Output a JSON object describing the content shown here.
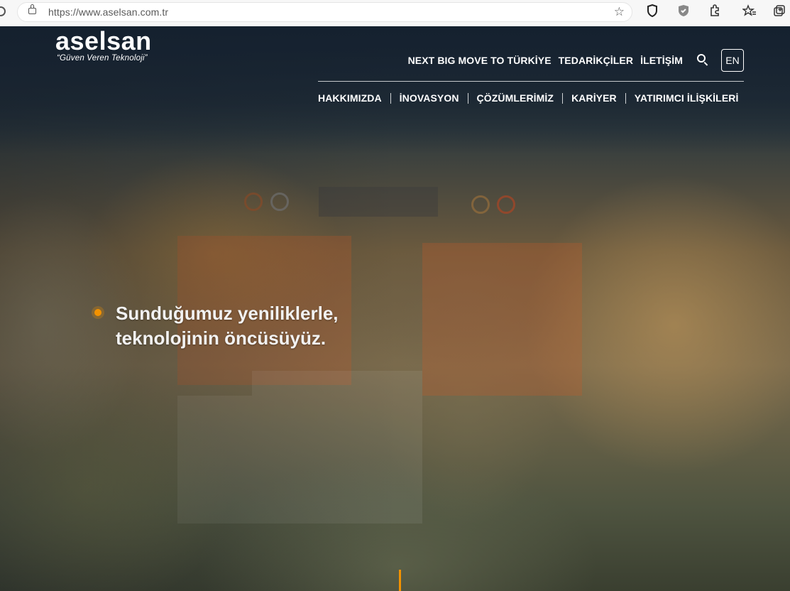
{
  "browser": {
    "url": "https://www.aselsan.com.tr",
    "icons": [
      "reload-icon",
      "lock-icon",
      "favorite-add-icon",
      "shield-icon",
      "tracking-icon",
      "extensions-icon",
      "favorites-icon",
      "collections-icon"
    ]
  },
  "site": {
    "logo_name": "aselsan",
    "logo_tagline": "“Güven Veren Teknoloji”"
  },
  "topnav": {
    "items": [
      "NEXT BIG MOVE TO TÜRKİYE",
      "TEDARİKÇİLER",
      "İLETİŞİM"
    ],
    "lang": "EN"
  },
  "mainnav": {
    "items": [
      "HAKKIMIZDA",
      "İNOVASYON",
      "ÇÖZÜMLERİMİZ",
      "KARİYER",
      "YATIRIMCI İLİŞKİLERİ"
    ]
  },
  "hero": {
    "headline_line1": "Sunduğumuz yeniliklerle,",
    "headline_line2": "teknolojinin öncüsüyüz.",
    "accent_color": "#f39200"
  }
}
